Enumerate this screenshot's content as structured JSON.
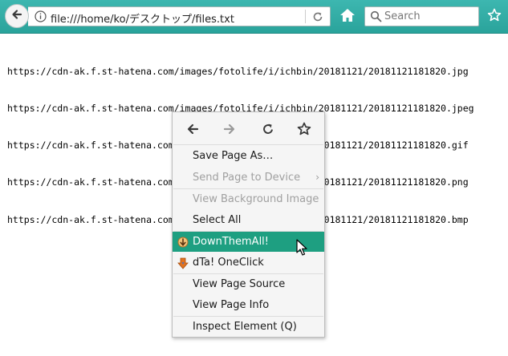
{
  "toolbar": {
    "url": "file:///home/ko/デスクトップ/files.txt",
    "search_placeholder": "Search"
  },
  "page": {
    "lines": [
      "https://cdn-ak.f.st-hatena.com/images/fotolife/i/ichbin/20181121/20181121181820.jpg",
      "https://cdn-ak.f.st-hatena.com/images/fotolife/i/ichbin/20181121/20181121181820.jpeg",
      "https://cdn-ak.f.st-hatena.com/images/fotolife/i/ichbin/20181121/20181121181820.gif",
      "https://cdn-ak.f.st-hatena.com/images/fotolife/i/ichbin/20181121/20181121181820.png",
      "https://cdn-ak.f.st-hatena.com/images/fotolife/i/ichbin/20181121/20181121181820.bmp"
    ]
  },
  "context_menu": {
    "nav_icons": [
      "back-arrow-icon",
      "forward-arrow-icon",
      "reload-icon",
      "bookmark-star-icon"
    ],
    "items": [
      {
        "label": "Save Page As…",
        "enabled": true
      },
      {
        "label": "Send Page to Device",
        "enabled": false,
        "submenu": true
      },
      {
        "label": "View Background Image",
        "enabled": false
      },
      {
        "label": "Select All",
        "enabled": true
      },
      {
        "label": "DownThemAll!",
        "enabled": true,
        "highlighted": true,
        "icon": "downthemall-icon"
      },
      {
        "label": "dTa! OneClick",
        "enabled": true,
        "icon": "dta-oneclick-icon"
      },
      {
        "label": "View Page Source",
        "enabled": true
      },
      {
        "label": "View Page Info",
        "enabled": true
      },
      {
        "label": "Inspect Element (Q)",
        "enabled": true
      }
    ],
    "submenu_arrow": "›"
  },
  "colors": {
    "toolbar": "#2aa39b",
    "menu_highlight": "#1e9f81",
    "disabled_text": "#a0a0a0"
  }
}
